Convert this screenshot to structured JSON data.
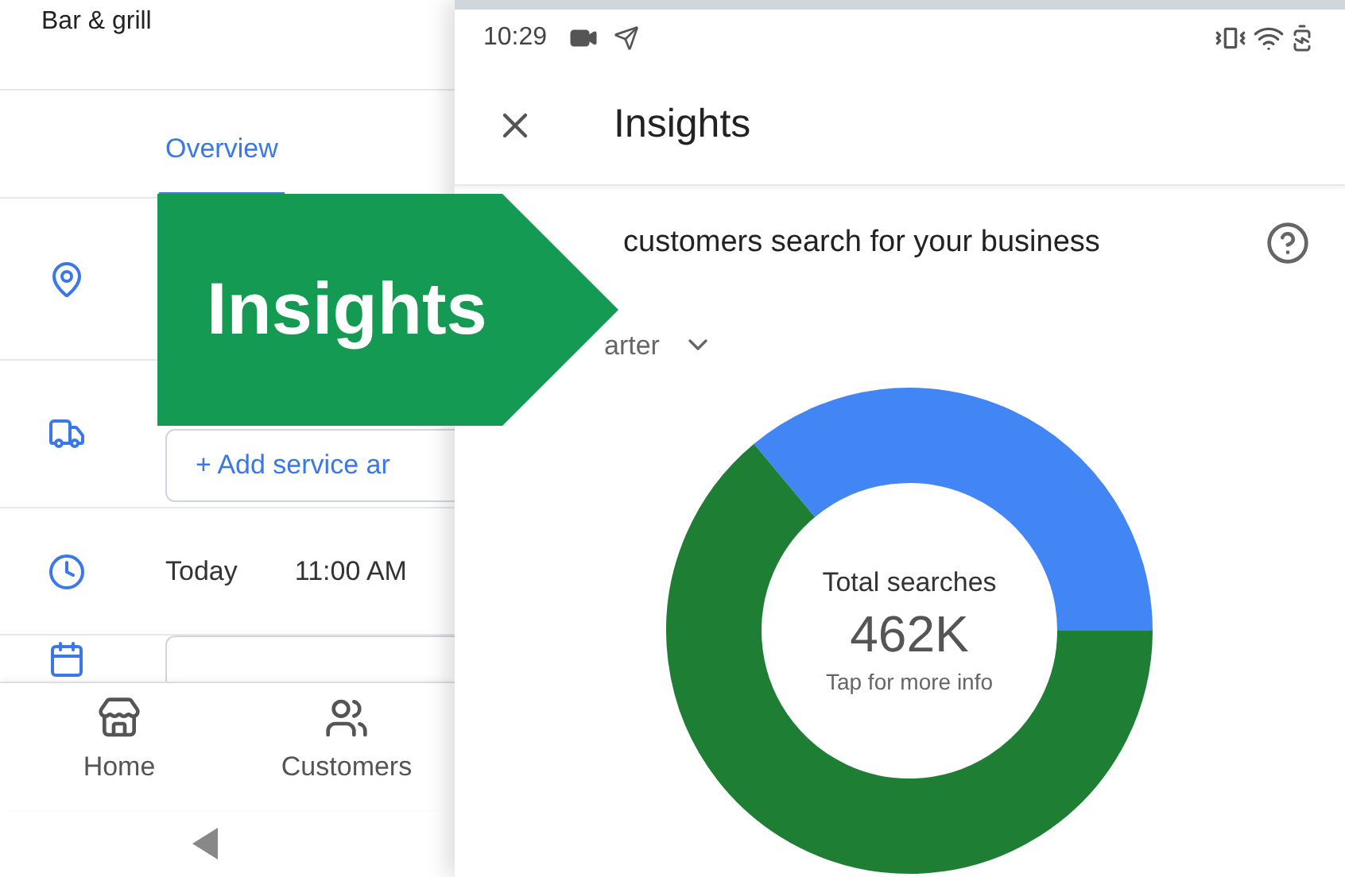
{
  "left_screen": {
    "title": "Bar & grill",
    "tabs": [
      {
        "label": "Overview",
        "selected": true
      }
    ],
    "rows": [
      {
        "kind": "location"
      },
      {
        "kind": "service",
        "field": "+ Add service ar"
      },
      {
        "kind": "hours",
        "day": "Today",
        "time": "11:00 AM"
      },
      {
        "kind": "calendar"
      }
    ],
    "bottom_nav": [
      {
        "kind": "home",
        "label": "Home"
      },
      {
        "kind": "customers",
        "label": "Customers"
      }
    ]
  },
  "right_screen": {
    "status_bar": {
      "time": "10:29"
    },
    "header": {
      "title": "Insights"
    },
    "section": {
      "heading": "customers search for your business",
      "period": "arter"
    },
    "donut": {
      "title": "Total searches",
      "value": "462K",
      "hint": "Tap for more info"
    }
  },
  "callout": {
    "label": "Insights"
  }
}
